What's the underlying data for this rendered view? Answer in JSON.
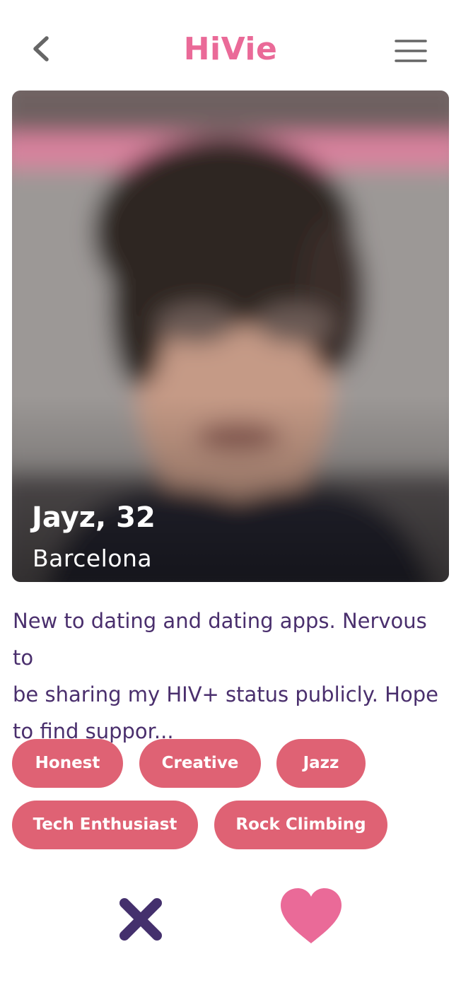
{
  "header": {
    "brand": "HiVie",
    "back_icon": "chevron-left-icon",
    "menu_icon": "hamburger-menu-icon"
  },
  "profile": {
    "name_age": "Jayz, 32",
    "city": "Barcelona",
    "bio_lines": [
      "New to dating and dating apps. Nervous to",
      "be sharing my HIV+ status publicly. Hope",
      "to find suppor..."
    ],
    "tags": [
      "Honest",
      "Creative",
      "Jazz",
      "Tech Enthusiast",
      "Rock Climbing"
    ]
  },
  "actions": {
    "pass_icon": "close-x-icon",
    "like_icon": "heart-icon"
  },
  "colors": {
    "brand": "#ea6a98",
    "text": "#4a2f6d",
    "tag_bg": "#df6274",
    "pass": "#44306d",
    "like": "#ea6a98"
  }
}
